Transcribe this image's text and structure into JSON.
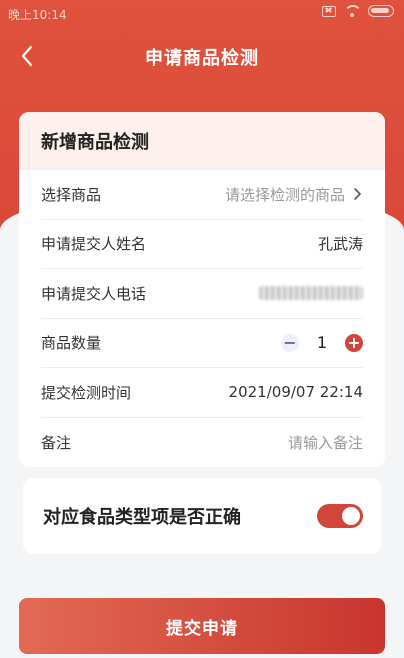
{
  "status_bar": {
    "time": "晚上10:14"
  },
  "header": {
    "title": "申请商品检测"
  },
  "form_card": {
    "title": "新增商品检测",
    "rows": [
      {
        "label": "选择商品",
        "placeholder": "请选择检测的商品"
      },
      {
        "label": "申请提交人姓名",
        "value": "孔武涛"
      },
      {
        "label": "申请提交人电话"
      },
      {
        "label": "商品数量",
        "quantity": "1"
      },
      {
        "label": "提交检测时间",
        "value": "2021/09/07 22:14"
      },
      {
        "label": "备注",
        "placeholder": "请输入备注"
      }
    ]
  },
  "food_type_card": {
    "label": "对应食品类型项是否正确",
    "toggle_on": true
  },
  "submit": {
    "label": "提交申请"
  },
  "colors": {
    "accent": "#d2453a",
    "header_bg": "#e0523d",
    "card_header_bg": "#fdf0ec"
  }
}
